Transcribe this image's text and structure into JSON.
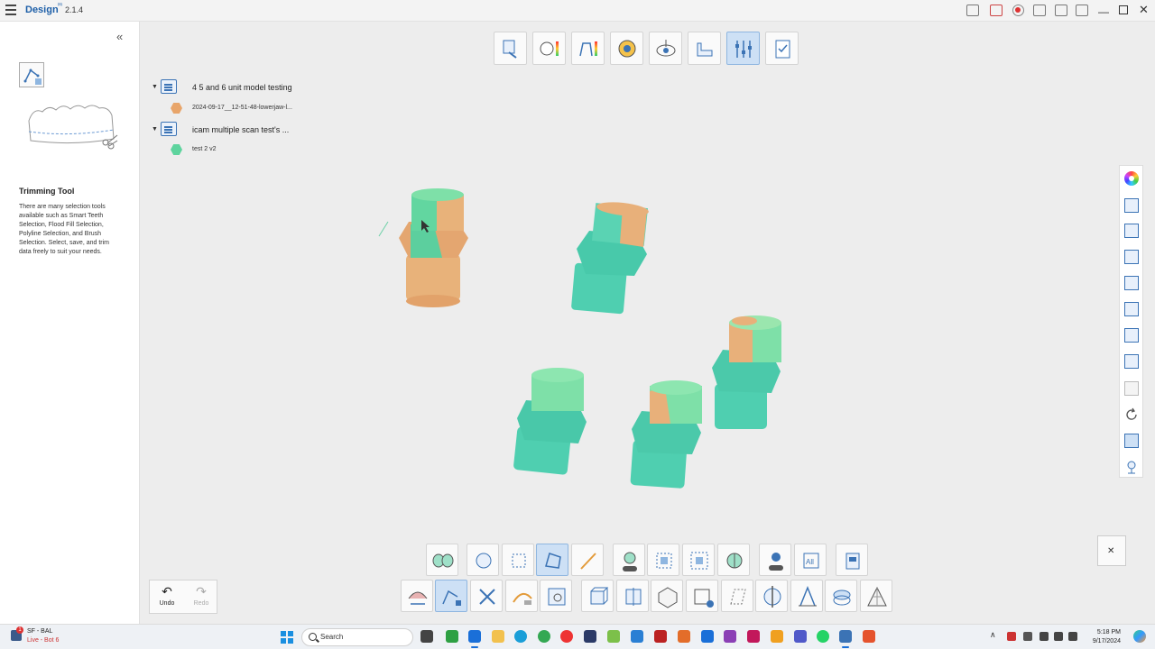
{
  "titlebar": {
    "app_name": "Design",
    "app_sup": "ᴾᴿ",
    "version": "2.1.4"
  },
  "left_panel": {
    "tool_title": "Trimming Tool",
    "tool_description": "There are many selection tools available such as Smart Teeth Selection, Flood Fill Selection, Polyline Selection, and Brush Selection. Select, save, and trim data freely to suit your needs."
  },
  "tree": {
    "groups": [
      {
        "label": "4 5 and 6 unit model testing",
        "child": "2024-09-17__12-51-48-lowerjaw-l...",
        "child_color": "orange"
      },
      {
        "label": "icam multiple scan test's ...",
        "child": "test 2 v2",
        "child_color": "green"
      }
    ]
  },
  "undo_redo": {
    "undo": "Undo",
    "redo": "Redo"
  },
  "taskbar": {
    "weather_title": "SF - BAL",
    "weather_sub": "Live - Bot 6",
    "weather_badge": "1",
    "search_placeholder": "Search",
    "time": "5:18 PM",
    "date": "9/17/2024"
  },
  "colors": {
    "orange": "#e8a56a",
    "green": "#5ed49e",
    "teal": "#4fcfb0",
    "accent": "#3b73b5"
  },
  "icons": {
    "top_toolbar": [
      "import-icon",
      "scan-compare-icon",
      "deviation-icon",
      "margin-icon",
      "axis-icon",
      "base-icon",
      "trimming-tools-icon",
      "checklist-icon"
    ],
    "bottom_row1": [
      "smart-teeth-icon",
      "flood-fill-icon",
      "rect-select-icon",
      "polyline-select-icon",
      "brush-select-icon",
      "invert-off-icon",
      "shrink-icon",
      "expand-icon",
      "split-icon",
      "deselect-off-icon",
      "select-all-icon",
      "save-selection-icon"
    ],
    "bottom_row2": [
      "jaw-swap-icon",
      "trim-icon",
      "fill-hole-icon",
      "smooth-icon",
      "inspect-icon",
      "box-view-icon",
      "section-icon",
      "solid-icon",
      "frame-add-icon",
      "remesh-icon",
      "cross-section-icon",
      "measure-icon",
      "layers-icon",
      "mesh-icon"
    ],
    "right_toolbar": [
      "color-wheel-icon",
      "view-front-icon",
      "view-back-icon",
      "view-left-icon",
      "view-right-icon",
      "view-top-icon",
      "view-bottom-icon",
      "view-iso-icon",
      "split-view-icon",
      "reset-rotation-icon",
      "screenshot-icon",
      "pin-icon"
    ]
  }
}
